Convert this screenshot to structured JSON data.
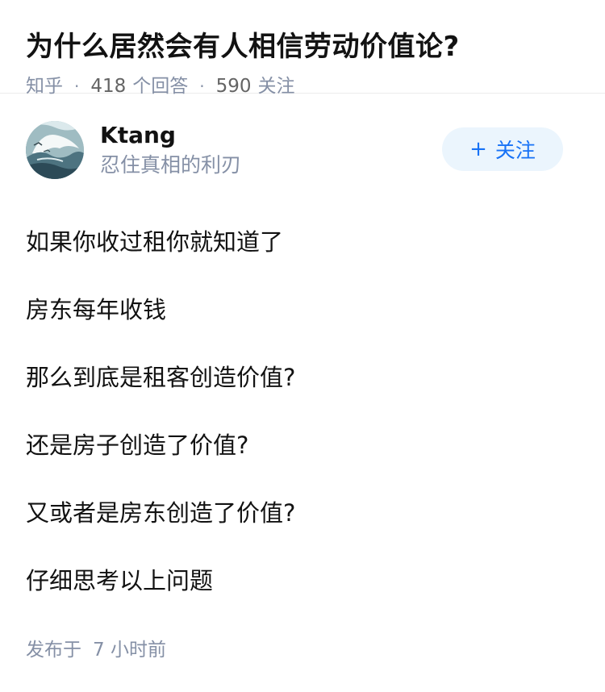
{
  "question": {
    "title": "为什么居然会有人相信劳动价值论?",
    "source": "知乎",
    "answer_count": "418",
    "answer_label": "个回答",
    "follow_count": "590",
    "follow_label": "关注"
  },
  "author": {
    "name": "Ktang",
    "bio": "忍住真相的利刃",
    "follow_button_plus": "+",
    "follow_button_label": "关注",
    "avatar_icon": "sea-waves-avatar"
  },
  "answer": {
    "paragraphs": [
      "如果你收过租你就知道了",
      "房东每年收钱",
      "那么到底是租客创造价值?",
      "还是房子创造了价值?",
      "又或者是房东创造了价值?",
      "仔细思考以上问题"
    ],
    "publish_prefix": "发布于",
    "publish_time": "7 小时前"
  },
  "colors": {
    "text": "#121212",
    "meta": "#8590a6",
    "accent": "#1772f6",
    "accent_bg": "#ebf5fd"
  }
}
